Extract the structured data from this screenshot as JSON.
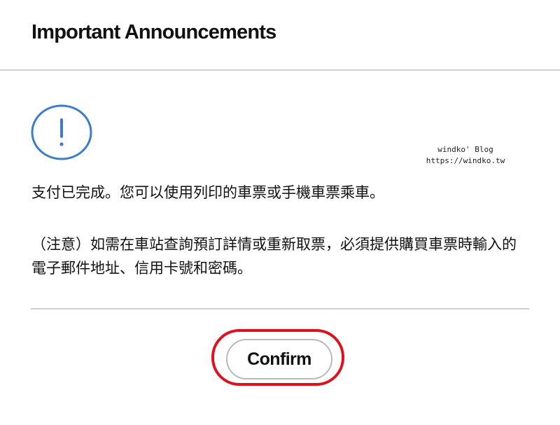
{
  "dialog": {
    "title": "Important Announcements",
    "icon": "exclamation-circle-icon",
    "accent_color": "#3d7cc9",
    "message": "支付已完成。您可以使用列印的車票或手機車票乘車。",
    "note_lines": [
      "（注意）如需在車站查詢預訂詳情或重新取票，必須提供購買車票時輸入的",
      "電子郵件地址、信用卡號和密碼。"
    ],
    "confirm_label": "Confirm",
    "highlight_color": "#e0101e"
  },
  "watermark": {
    "line1": "windko' Blog",
    "line2": "https://windko.tw"
  }
}
